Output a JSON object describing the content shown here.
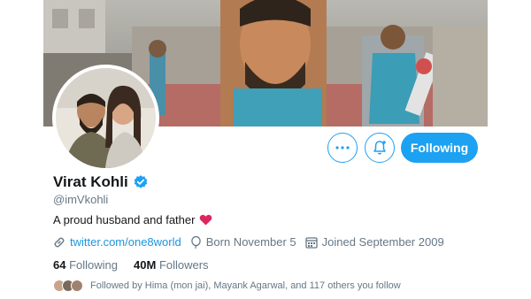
{
  "colors": {
    "accent": "#1da1f2",
    "link": "#1b95e0",
    "muted_text": "#657786",
    "heart": "#e0245e"
  },
  "profile": {
    "display_name": "Virat Kohli",
    "handle": "@imVkohli",
    "verified": true,
    "bio": "A proud husband and father",
    "bio_emoji": "red-heart-icon",
    "website": "twitter.com/one8world",
    "birthday": "Born November 5",
    "joined": "Joined September 2009"
  },
  "actions": {
    "more_icon": "more-icon",
    "notify_icon": "bell-plus-icon",
    "follow_label": "Following"
  },
  "stats": {
    "following_count": "64",
    "following_label": "Following",
    "followers_count": "40M",
    "followers_label": "Followers"
  },
  "followed_by": {
    "text": "Followed by Hima (mon jai), Mayank Agarwal, and 117 others you follow"
  }
}
